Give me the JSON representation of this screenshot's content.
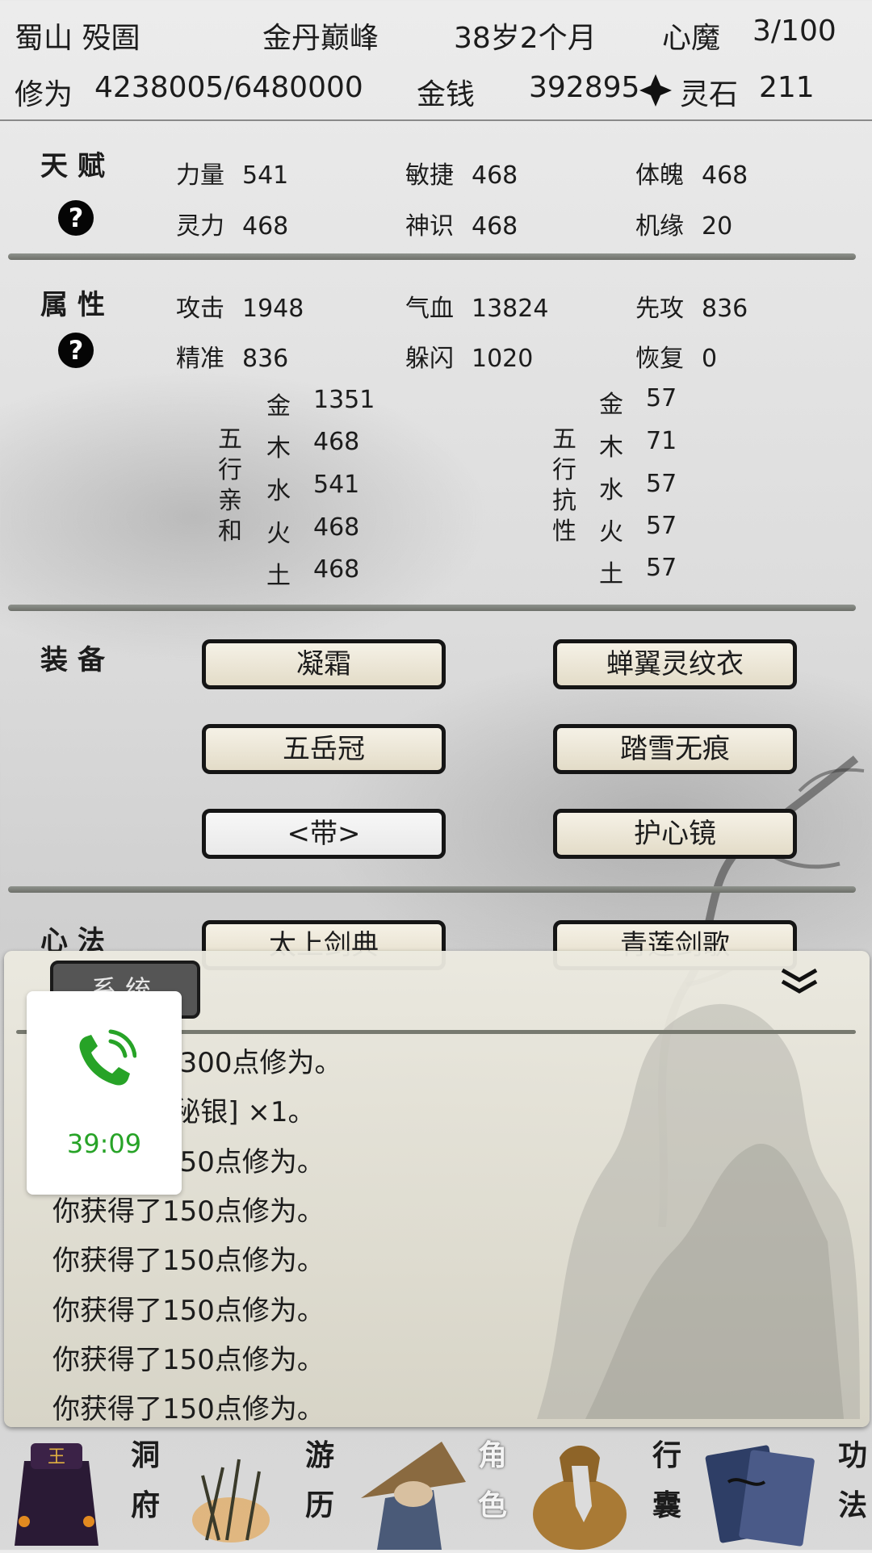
{
  "header": {
    "location": "蜀山 殁圄",
    "realm": "金丹巅峰",
    "age": "38岁2个月",
    "heart_demon_label": "心魔",
    "heart_demon_value": "3/100",
    "cultivation_label": "修为",
    "cultivation_value": "4238005/6480000",
    "money_label": "金钱",
    "money_value": "392895",
    "spirit_stone_label": "灵石",
    "spirit_stone_value": "211"
  },
  "talent": {
    "title": "天赋",
    "help": "?",
    "stats": [
      {
        "label": "力量",
        "value": "541"
      },
      {
        "label": "敏捷",
        "value": "468"
      },
      {
        "label": "体魄",
        "value": "468"
      },
      {
        "label": "灵力",
        "value": "468"
      },
      {
        "label": "神识",
        "value": "468"
      },
      {
        "label": "机缘",
        "value": "20"
      }
    ]
  },
  "attributes": {
    "title": "属性",
    "help": "?",
    "stats": [
      {
        "label": "攻击",
        "value": "1948"
      },
      {
        "label": "气血",
        "value": "13824"
      },
      {
        "label": "先攻",
        "value": "836"
      },
      {
        "label": "精准",
        "value": "836"
      },
      {
        "label": "躲闪",
        "value": "1020"
      },
      {
        "label": "恢复",
        "value": "0"
      }
    ],
    "affinity_label": [
      "五",
      "行",
      "亲",
      "和"
    ],
    "affinity": [
      {
        "element": "金",
        "value": "1351"
      },
      {
        "element": "木",
        "value": "468"
      },
      {
        "element": "水",
        "value": "541"
      },
      {
        "element": "火",
        "value": "468"
      },
      {
        "element": "土",
        "value": "468"
      }
    ],
    "resistance_label": [
      "五",
      "行",
      "抗",
      "性"
    ],
    "resistance": [
      {
        "element": "金",
        "value": "57"
      },
      {
        "element": "木",
        "value": "71"
      },
      {
        "element": "水",
        "value": "57"
      },
      {
        "element": "火",
        "value": "57"
      },
      {
        "element": "土",
        "value": "57"
      }
    ]
  },
  "equipment": {
    "title": "装备",
    "slots": [
      "凝霜",
      "蝉翼灵纹衣",
      "五岳冠",
      "踏雪无痕",
      "<带>",
      "护心镜"
    ]
  },
  "mind_method": {
    "title": "心法",
    "slots": [
      "太上剑典",
      "青莲剑歌"
    ]
  },
  "log": {
    "tab_label": "系统",
    "lines": [
      "你获得了1300点修为。",
      "你获得了[秘银] ×1。",
      "你获得了150点修为。",
      "你获得了150点修为。",
      "你获得了150点修为。",
      "你获得了150点修为。",
      "你获得了150点修为。",
      "你获得了150点修为。"
    ]
  },
  "call_overlay": {
    "icon": "phone-icon",
    "time": "39:09",
    "color": "#27a327"
  },
  "nav": [
    {
      "label": [
        "洞",
        "府"
      ],
      "icon": "cave-abode-icon"
    },
    {
      "label": [
        "游",
        "历"
      ],
      "icon": "travel-icon"
    },
    {
      "label": [
        "角",
        "色"
      ],
      "icon": "character-icon"
    },
    {
      "label": [
        "行",
        "囊"
      ],
      "icon": "bag-icon"
    },
    {
      "label": [
        "功",
        "法"
      ],
      "icon": "scroll-books-icon"
    }
  ]
}
